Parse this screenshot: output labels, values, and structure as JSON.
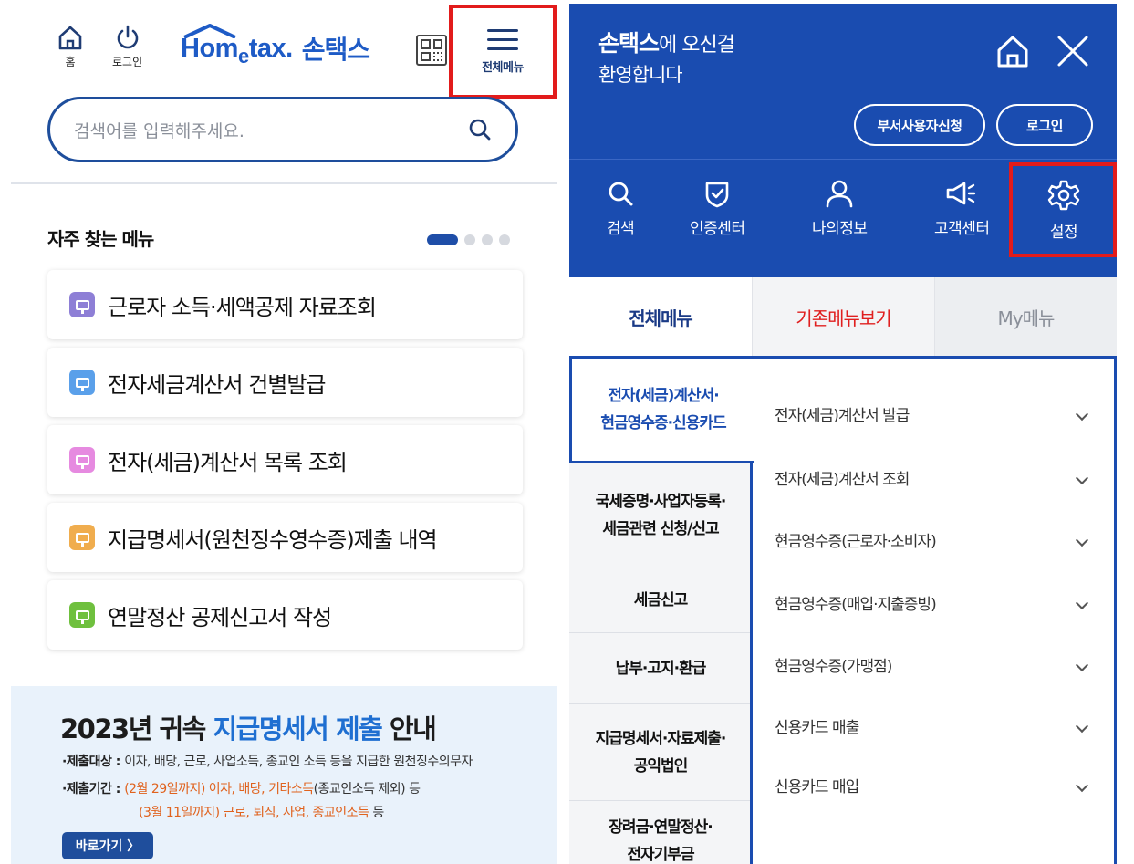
{
  "left": {
    "header": {
      "home_label": "홈",
      "login_label": "로그인",
      "logo_en": "Hom",
      "logo_e": "e",
      "logo_en_tail": "tax.",
      "logo_ko": "손택스",
      "menu_label": "전체메뉴"
    },
    "search": {
      "placeholder": "검색어를 입력해주세요."
    },
    "favorites": {
      "title": "자주 찾는 메뉴",
      "pager": {
        "pages": 4,
        "current": 1
      },
      "items": [
        {
          "label": "근로자 소득·세액공제 자료조회",
          "icon_color": "#8e7fd6"
        },
        {
          "label": "전자세금계산서 건별발급",
          "icon_color": "#5aa0ea"
        },
        {
          "label": "전자(세금)계산서 목록 조회",
          "icon_color": "#e68ae0"
        },
        {
          "label": "지급명세서(원천징수영수증)제출 내역",
          "icon_color": "#f0ad4e"
        },
        {
          "label": "연말정산 공제신고서 작성",
          "icon_color": "#6fc03e"
        }
      ]
    },
    "notice": {
      "title_pre": "2023년 귀속 ",
      "title_hl": "지급명세서 제출",
      "title_post": " 안내",
      "line1_label": "·제출대상 : ",
      "line1_text": "이자, 배당, 근로, 사업소득, 종교인 소득 등을 지급한 원천징수의무자",
      "line2_label": "·제출기간 : ",
      "line2_red": "(2월 29일까지) 이자, 배당, 기타소득",
      "line2_text": "(종교인소득 제외) 등",
      "line3_red": "(3월 11일까지) 근로, 퇴직, 사업, 종교인소득",
      "line3_text": " 등",
      "button": "바로가기 〉"
    }
  },
  "right": {
    "welcome_bold": "손택스",
    "welcome_rest": "에 오신걸",
    "welcome_line2": "환영합니다",
    "btn_dept": "부서사용자신청",
    "btn_login": "로그인",
    "quick": [
      {
        "label": "검색",
        "icon": "search-icon"
      },
      {
        "label": "인증센터",
        "icon": "shield-check-icon"
      },
      {
        "label": "나의정보",
        "icon": "user-icon"
      },
      {
        "label": "고객센터",
        "icon": "megaphone-icon"
      },
      {
        "label": "설정",
        "icon": "gear-icon"
      }
    ],
    "tabs": [
      {
        "label": "전체메뉴",
        "active": true
      },
      {
        "label": "기존메뉴보기",
        "color": "#e01f1f"
      },
      {
        "label": "My메뉴"
      }
    ],
    "categories": [
      {
        "l1": "전자(세금)계산서·",
        "l2": "현금영수증·신용카드",
        "active": true
      },
      {
        "l1": "국세증명·사업자등록·",
        "l2": "세금관련 신청/신고"
      },
      {
        "l1": "세금신고",
        "l2": ""
      },
      {
        "l1": "납부·고지·환급",
        "l2": ""
      },
      {
        "l1": "지급명세서·자료제출·",
        "l2": "공익법인"
      },
      {
        "l1": "장려금·연말정산·",
        "l2": "전자기부금"
      }
    ],
    "submenu": [
      "전자(세금)계산서 발급",
      "전자(세금)계산서 조회",
      "현금영수증(근로자·소비자)",
      "현금영수증(매입·지출증빙)",
      "현금영수증(가맹점)",
      "신용카드 매출",
      "신용카드 매입"
    ]
  }
}
